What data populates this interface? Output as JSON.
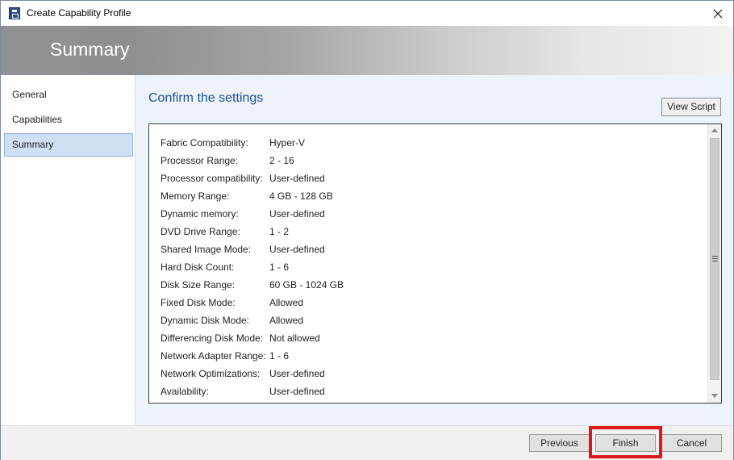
{
  "window": {
    "title": "Create Capability Profile",
    "close_icon": "close-icon"
  },
  "banner": {
    "title": "Summary"
  },
  "nav": {
    "items": [
      {
        "label": "General",
        "selected": false
      },
      {
        "label": "Capabilities",
        "selected": false
      },
      {
        "label": "Summary",
        "selected": true
      }
    ]
  },
  "main": {
    "heading": "Confirm the settings",
    "view_script_label": "View Script",
    "settings": [
      {
        "label": "Fabric Compatibility:",
        "value": "Hyper-V"
      },
      {
        "label": "Processor Range:",
        "value": "2 - 16"
      },
      {
        "label": "Processor compatibility:",
        "value": "User-defined"
      },
      {
        "label": "Memory Range:",
        "value": "4  GB - 128  GB"
      },
      {
        "label": "Dynamic memory:",
        "value": "User-defined"
      },
      {
        "label": "DVD Drive Range:",
        "value": "1 - 2"
      },
      {
        "label": "Shared Image Mode:",
        "value": "User-defined"
      },
      {
        "label": "Hard Disk Count:",
        "value": "1 - 6"
      },
      {
        "label": "Disk Size Range:",
        "value": "60  GB - 1024  GB"
      },
      {
        "label": "Fixed Disk Mode:",
        "value": "Allowed"
      },
      {
        "label": "Dynamic Disk Mode:",
        "value": "Allowed"
      },
      {
        "label": "Differencing Disk Mode:",
        "value": "Not allowed"
      },
      {
        "label": "Network Adapter Range:",
        "value": "1 - 6"
      },
      {
        "label": "Network Optimizations:",
        "value": "User-defined"
      },
      {
        "label": "Availability:",
        "value": "User-defined"
      }
    ]
  },
  "footer": {
    "previous_label": "Previous",
    "finish_label": "Finish",
    "cancel_label": "Cancel",
    "highlight_color": "#e0161e"
  },
  "colors": {
    "accent_heading": "#1c4f92",
    "nav_selected": "#cfe0f4"
  }
}
